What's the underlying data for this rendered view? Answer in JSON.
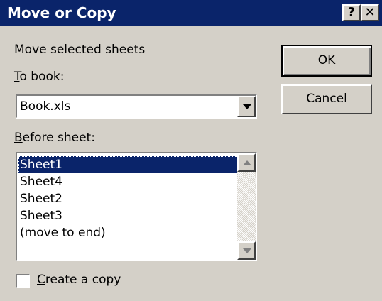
{
  "window": {
    "title": "Move or Copy"
  },
  "titlebar": {
    "help_label": "?",
    "close_label": "✕"
  },
  "main": {
    "heading": "Move selected sheets",
    "to_book_label_mnemonic": "T",
    "to_book_label_rest": "o book:",
    "to_book_value": "Book.xls",
    "before_sheet_label_mnemonic": "B",
    "before_sheet_label_rest": "efore sheet:",
    "sheets": [
      "Sheet1",
      "Sheet4",
      "Sheet2",
      "Sheet3",
      "(move to end)"
    ],
    "selected_sheet": "Sheet1",
    "create_copy_mnemonic": "C",
    "create_copy_rest": "reate a copy",
    "create_copy_checked": false
  },
  "buttons": {
    "ok_label": "OK",
    "cancel_label": "Cancel"
  },
  "colors": {
    "titlebar": "#0a246a",
    "face": "#d4d0c8",
    "selection": "#0a246a"
  }
}
